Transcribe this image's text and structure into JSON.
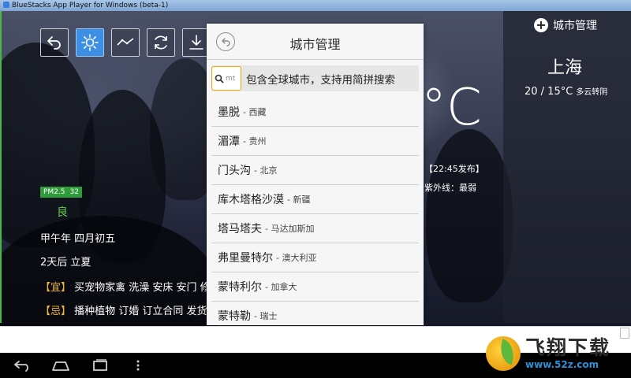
{
  "window": {
    "title": "BlueStacks App Player for Windows (beta-1)"
  },
  "toolbar": {
    "icons": [
      "back-arrow-icon",
      "sun-icon",
      "trend-line-icon",
      "refresh-icon",
      "download-icon"
    ],
    "active": "sun-icon"
  },
  "weather": {
    "city_manage_label": "城市管理",
    "city": "上海",
    "temp_range": "20 / 15°C",
    "condition": "多云转阴",
    "current_temp_partial": "°C",
    "publish_time": "【22:45发布】",
    "uv": "紫外线：最弱",
    "pm25_label": "PM2.5",
    "pm25_value": "32",
    "air_quality": "良",
    "lunar_date": "甲午年 四月初五",
    "solar_term": "2天后 立夏",
    "yi_tag": "【宜】",
    "yi_text": "买宠物家禽 洗澡 安床 安门 修",
    "ji_tag": "【忌】",
    "ji_text": "播种植物 订婚 订立合同 发货"
  },
  "dialog": {
    "title": "城市管理",
    "search": {
      "value": "mt",
      "hint": "包含全球城市，支持用简拼搜索"
    },
    "cities": [
      {
        "name": "墨脱",
        "region": "- 西藏"
      },
      {
        "name": "湄潭",
        "region": "- 贵州"
      },
      {
        "name": "门头沟",
        "region": "- 北京"
      },
      {
        "name": "库木塔格沙漠",
        "region": "- 新疆"
      },
      {
        "name": "塔马塔夫",
        "region": "- 马达加斯加"
      },
      {
        "name": "弗里曼特尔",
        "region": "- 澳大利亚"
      },
      {
        "name": "蒙特利尔",
        "region": "- 加拿大"
      },
      {
        "name": "蒙特勒",
        "region": "- 瑞士"
      }
    ]
  },
  "watermark": {
    "brand": "飞翔下载",
    "url": "www.52z.com"
  },
  "colors": {
    "accent_blue": "#3d8fe6",
    "pm_green": "#2f9b3a",
    "tag_orange": "#f4b93a",
    "search_border": "#f0a500"
  }
}
